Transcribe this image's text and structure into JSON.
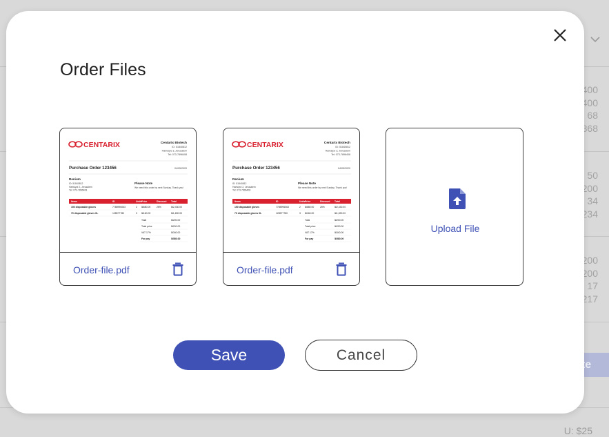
{
  "background": {
    "value_groups": [
      [
        "400",
        "400",
        "68",
        "868"
      ],
      [
        "50",
        "200",
        "34",
        "234"
      ],
      [
        "200",
        "200",
        "17",
        "217"
      ]
    ],
    "partial_button_label": "ate",
    "total_text": "U: $25"
  },
  "modal": {
    "title": "Order Files",
    "close_icon": "close-icon",
    "files": [
      {
        "name": "Order-file.pdf",
        "delete_icon": "trash-icon"
      },
      {
        "name": "Order-file.pdf",
        "delete_icon": "trash-icon"
      }
    ],
    "upload": {
      "label": "Upload File",
      "icon": "file-upload-icon"
    },
    "save_label": "Save",
    "cancel_label": "Cancel"
  },
  "preview_document": {
    "brand": "CENTARIX",
    "company": "Centarix Biotech",
    "company_lines": [
      "ID: 51840812",
      "Hamarpe 3, Jerusalem",
      "Tel: 073-7896408"
    ],
    "po_title": "Purchase Order 123456",
    "po_date": "04/05/2020",
    "vendor": "Renium",
    "vendor_lines": [
      "ID: 51840812",
      "Hartsiyot 2, Jerusalem",
      "Tel: 073-7896408"
    ],
    "note_title": "Please Note",
    "note_text": "We need this order by next Sunday. Thank you!",
    "table_headers": [
      "Items",
      "ID",
      "Units",
      "Price",
      "Discount",
      "Total"
    ],
    "rows": [
      [
        "150 disposable gloves",
        "7785996063",
        "2",
        "₪680.00",
        "25%",
        "₪2,430.00"
      ],
      [
        "70 disposable gloves XL",
        "128577780",
        "3",
        "₪160.00",
        "",
        "₪1,690.00"
      ]
    ],
    "summary": [
      [
        "Total",
        "₪200.00"
      ],
      [
        "Total price",
        "₪200.00"
      ],
      [
        "VAT 17%",
        "₪340.00"
      ],
      [
        "For pay",
        "₪580.00"
      ]
    ],
    "colors": {
      "brand_red": "#d8202f",
      "accent_blue": "#3f51b5"
    }
  }
}
